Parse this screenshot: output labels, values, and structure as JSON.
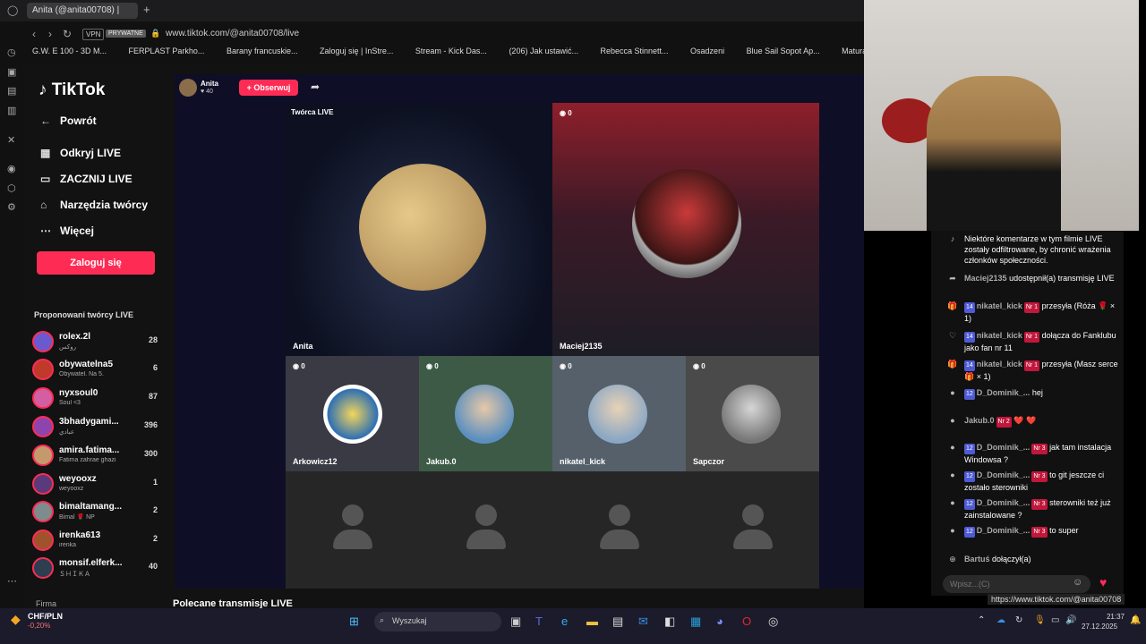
{
  "browser": {
    "tab_title": "Anita (@anita00708) |",
    "url": "www.tiktok.com/@anita00708/live",
    "vpn_badge": "VPN",
    "private_badge": "PRYWATNE",
    "bookmarks": [
      "G.W. E 100 - 3D M...",
      "FERPLAST Parkho...",
      "Barany francuskie...",
      "Zaloguj się | InStre...",
      "Stream - Kick Das...",
      "(206) Jak ustawić...",
      "Rebecca Stinnett...",
      "Osadzeni",
      "Blue Sail Sopot Ap...",
      "Matura mate"
    ]
  },
  "tiktok": {
    "logo": "TikTok",
    "nav": {
      "back": "Powrót",
      "discover": "Odkryj LIVE",
      "start": "ZACZNIJ LIVE",
      "tools": "Narzędzia twórcy",
      "more": "Więcej"
    },
    "login_button": "Zaloguj się",
    "suggested_title": "Proponowani twórcy LIVE",
    "creators": [
      {
        "name": "rolex.2l",
        "sub": "روکس",
        "count": "28"
      },
      {
        "name": "obywatelna5",
        "sub": "Obywatel. Na 5.",
        "count": "6"
      },
      {
        "name": "nyxsoul0",
        "sub": "Soul <3",
        "count": "87"
      },
      {
        "name": "3bhadygami...",
        "sub": "عبادي",
        "count": "396"
      },
      {
        "name": "amira.fatima...",
        "sub": "Fatima zahrae ghazi",
        "count": "300"
      },
      {
        "name": "weyooxz",
        "sub": "weyooxz",
        "count": "1"
      },
      {
        "name": "bimaltamang...",
        "sub": "Bimal 🌹 NP",
        "count": "2"
      },
      {
        "name": "irenka613",
        "sub": "irenka",
        "count": "2"
      },
      {
        "name": "monsif.elferk...",
        "sub": "ＳＨＩＫＡ",
        "count": "40"
      }
    ],
    "footer_link": "Firma",
    "recommended": "Polecane transmisje LIVE"
  },
  "stream": {
    "host_name": "Anita",
    "host_likes": "40",
    "follow_button": "+ Obserwuj",
    "creator_live_label": "Twórca LIVE",
    "main_cells": [
      {
        "name": "Anita",
        "count": ""
      },
      {
        "name": "Maciej2135",
        "count": "0"
      }
    ],
    "guest_cells": [
      {
        "name": "Arkowicz12",
        "count": "0"
      },
      {
        "name": "Jakub.0",
        "count": "0"
      },
      {
        "name": "nikatel_kick",
        "count": "0"
      },
      {
        "name": "Sapczor",
        "count": "0"
      }
    ]
  },
  "chat": {
    "notice": "Niektóre komentarze w tym filmie LIVE zostały odfiltrowane, by chronić wrażenia członków społeczności.",
    "messages": [
      {
        "user": "Maciej2135",
        "text": "udostępnił(a) transmisję LIVE",
        "level": "",
        "fan": ""
      },
      {
        "user": "nikatel_kick",
        "text": "przesyła (Róża 🌹 × 1)",
        "level": "14",
        "fan": "Nr 1"
      },
      {
        "user": "nikatel_kick",
        "text": "dołącza do Fanklubu jako fan nr 11",
        "level": "14",
        "fan": "Nr 1"
      },
      {
        "user": "nikatel_kick",
        "text": "przesyła (Masz serce 🎁 × 1)",
        "level": "14",
        "fan": "Nr 1"
      },
      {
        "user": "D_Dominik_...",
        "text": "hej",
        "level": "12",
        "fan": ""
      },
      {
        "user": "Jakub.0",
        "text": "❤️ ❤️",
        "level": "",
        "fan": "Nr 2"
      },
      {
        "user": "D_Dominik_...",
        "text": "jak tam instalacja Windowsa ?",
        "level": "12",
        "fan": "Nr 3"
      },
      {
        "user": "D_Dominik_...",
        "text": "to git jeszcze ci zostało sterowniki",
        "level": "12",
        "fan": "Nr 3"
      },
      {
        "user": "D_Dominik_...",
        "text": "sterowniki też już zainstalowane ?",
        "level": "12",
        "fan": "Nr 3"
      },
      {
        "user": "D_Dominik_...",
        "text": "to super",
        "level": "12",
        "fan": "Nr 3"
      },
      {
        "user": "Bartuś",
        "text": "dołączył(a)",
        "level": "",
        "fan": ""
      }
    ],
    "input_placeholder": "Wpisz...(C)",
    "tooltip": "https://www.tiktok.com/@anita00708"
  },
  "taskbar": {
    "currency": "CHF/PLN",
    "change": "-0,20%",
    "search_placeholder": "Wyszukaj",
    "time": "21:37",
    "date": "27.12.2025"
  }
}
